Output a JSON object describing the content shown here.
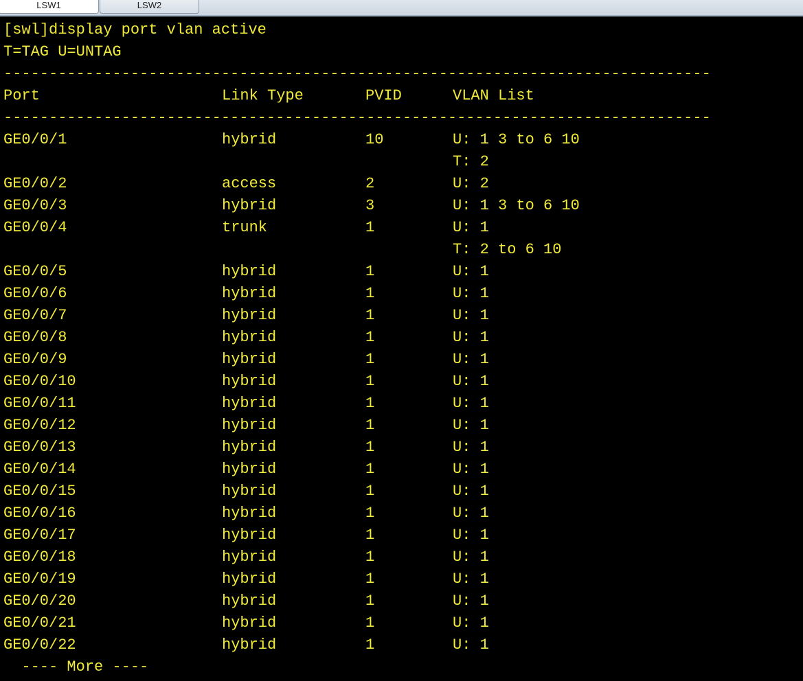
{
  "tabs": [
    {
      "label": "LSW1"
    },
    {
      "label": "LSW2"
    }
  ],
  "terminal": {
    "command": "[swl]display port vlan active",
    "legend": "T=TAG U=UNTAG",
    "separator": "------------------------------------------------------------------------------",
    "headers": {
      "port": "Port",
      "link_type": "Link Type",
      "pvid": "PVID",
      "vlan_list": "VLAN List"
    },
    "rows": [
      {
        "port": "GE0/0/1",
        "link_type": "hybrid",
        "pvid": "10",
        "vlan": "U: 1 3 to 6 10"
      },
      {
        "port": "",
        "link_type": "",
        "pvid": "",
        "vlan": "T: 2"
      },
      {
        "port": "GE0/0/2",
        "link_type": "access",
        "pvid": "2",
        "vlan": "U: 2"
      },
      {
        "port": "GE0/0/3",
        "link_type": "hybrid",
        "pvid": "3",
        "vlan": "U: 1 3 to 6 10"
      },
      {
        "port": "GE0/0/4",
        "link_type": "trunk",
        "pvid": "1",
        "vlan": "U: 1"
      },
      {
        "port": "",
        "link_type": "",
        "pvid": "",
        "vlan": "T: 2 to 6 10"
      },
      {
        "port": "GE0/0/5",
        "link_type": "hybrid",
        "pvid": "1",
        "vlan": "U: 1"
      },
      {
        "port": "GE0/0/6",
        "link_type": "hybrid",
        "pvid": "1",
        "vlan": "U: 1"
      },
      {
        "port": "GE0/0/7",
        "link_type": "hybrid",
        "pvid": "1",
        "vlan": "U: 1"
      },
      {
        "port": "GE0/0/8",
        "link_type": "hybrid",
        "pvid": "1",
        "vlan": "U: 1"
      },
      {
        "port": "GE0/0/9",
        "link_type": "hybrid",
        "pvid": "1",
        "vlan": "U: 1"
      },
      {
        "port": "GE0/0/10",
        "link_type": "hybrid",
        "pvid": "1",
        "vlan": "U: 1"
      },
      {
        "port": "GE0/0/11",
        "link_type": "hybrid",
        "pvid": "1",
        "vlan": "U: 1"
      },
      {
        "port": "GE0/0/12",
        "link_type": "hybrid",
        "pvid": "1",
        "vlan": "U: 1"
      },
      {
        "port": "GE0/0/13",
        "link_type": "hybrid",
        "pvid": "1",
        "vlan": "U: 1"
      },
      {
        "port": "GE0/0/14",
        "link_type": "hybrid",
        "pvid": "1",
        "vlan": "U: 1"
      },
      {
        "port": "GE0/0/15",
        "link_type": "hybrid",
        "pvid": "1",
        "vlan": "U: 1"
      },
      {
        "port": "GE0/0/16",
        "link_type": "hybrid",
        "pvid": "1",
        "vlan": "U: 1"
      },
      {
        "port": "GE0/0/17",
        "link_type": "hybrid",
        "pvid": "1",
        "vlan": "U: 1"
      },
      {
        "port": "GE0/0/18",
        "link_type": "hybrid",
        "pvid": "1",
        "vlan": "U: 1"
      },
      {
        "port": "GE0/0/19",
        "link_type": "hybrid",
        "pvid": "1",
        "vlan": "U: 1"
      },
      {
        "port": "GE0/0/20",
        "link_type": "hybrid",
        "pvid": "1",
        "vlan": "U: 1"
      },
      {
        "port": "GE0/0/21",
        "link_type": "hybrid",
        "pvid": "1",
        "vlan": "U: 1"
      },
      {
        "port": "GE0/0/22",
        "link_type": "hybrid",
        "pvid": "1",
        "vlan": "U: 1"
      }
    ],
    "more_prompt": "  ---- More ----"
  },
  "colors": {
    "text": "#f0ea3c",
    "background": "#000000"
  }
}
